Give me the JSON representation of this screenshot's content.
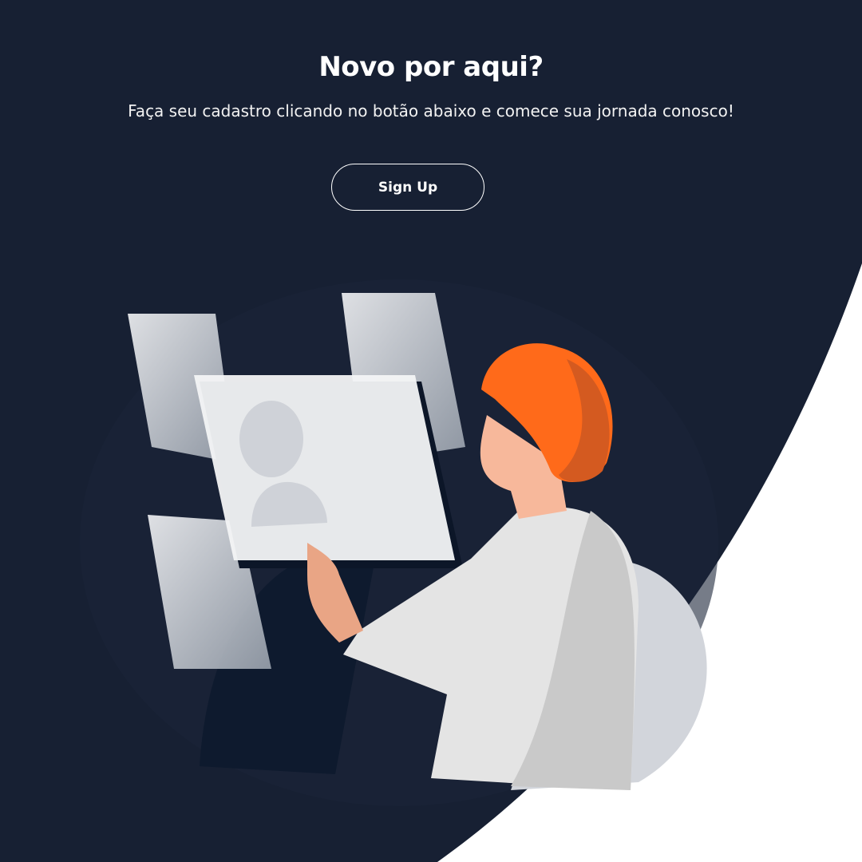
{
  "panel": {
    "title": "Novo por aqui?",
    "subtitle": "Faça seu cadastro clicando no botão abaixo e comece sua jornada conosco!",
    "signup_label": "Sign Up"
  },
  "colors": {
    "background": "#172033",
    "accent_hair": "#ff6a1a",
    "white": "#ffffff"
  }
}
